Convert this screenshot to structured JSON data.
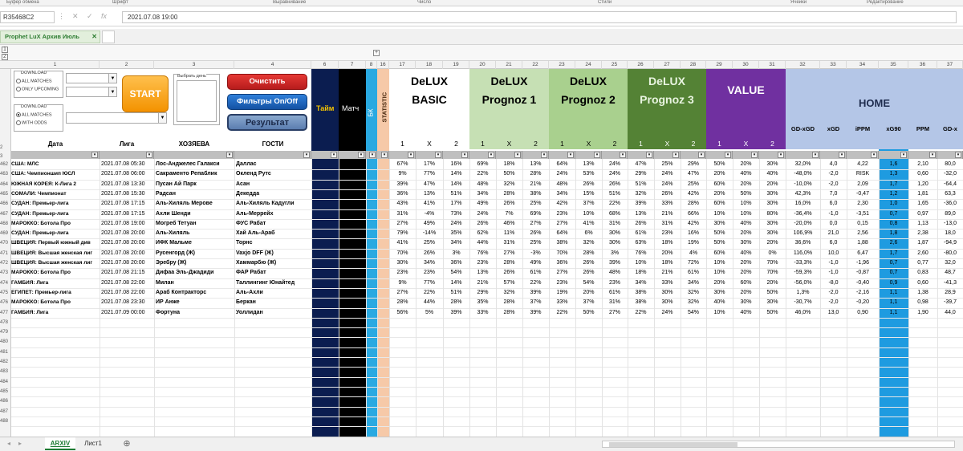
{
  "ribbon_groups": [
    "Буфер обмена",
    "Шрифт",
    "Выравнивание",
    "Число",
    "Стили",
    "Ячейки",
    "Редактирование"
  ],
  "namebox": "R35468C2",
  "formula_value": "2021.07.08 19:00",
  "workbook_tab": "Prophet LuX Архив Июль",
  "column_numbers": [
    "1",
    "2",
    "3",
    "4",
    "6",
    "7",
    "8",
    "16",
    "17",
    "18",
    "19",
    "20",
    "21",
    "22",
    "23",
    "24",
    "25",
    "26",
    "27",
    "28",
    "29",
    "30",
    "31",
    "32",
    "33",
    "34",
    "35",
    "36",
    "37"
  ],
  "row_header_top": "2",
  "row_header_filter": "3",
  "controls": {
    "download1_title": "DOWNLOAD",
    "download1_opt1": "ALL MATCHES",
    "download1_opt2": "ONLY UPCOMING",
    "download2_title": "DOWNLOAD",
    "download2_opt1": "ALL MATCHES",
    "download2_opt2": "WITH ODDS",
    "start": "START",
    "listbox_title": "Выбрать день",
    "btn_clear": "Очистить",
    "btn_filters": "Фильтры On/Off",
    "btn_result": "Результат"
  },
  "band_labels": {
    "taim": "Тайм",
    "match": "Матч",
    "bk": "БК",
    "statistic": "STATISTIC",
    "delux_basic_1": "DeLUX",
    "delux_basic_2": "BASIC",
    "p1_1": "DeLUX",
    "p1_2": "Prognoz 1",
    "p2_1": "DeLUX",
    "p2_2": "Prognoz 2",
    "p3_1": "DeLUX",
    "p3_2": "Prognoz 3",
    "value": "VALUE",
    "home": "HOME"
  },
  "home_cols": [
    "GD-xGD",
    "xGD",
    "iPPM",
    "xG90",
    "PPM",
    "GD-x"
  ],
  "col_headers": [
    "Дата",
    "Лига",
    "ХОЗЯЕВА",
    "ГОСТИ"
  ],
  "x12": [
    "1",
    "X",
    "2"
  ],
  "rows": [
    {
      "n": "462",
      "lg": "США: МЛС",
      "dt": "2021.07.08 05:30",
      "h": "Лос-Анджелес Галакси",
      "a": "Даллас",
      "v": [
        "67%",
        "17%",
        "16%",
        "69%",
        "18%",
        "13%",
        "64%",
        "13%",
        "24%",
        "47%",
        "25%",
        "29%",
        "50%",
        "20%",
        "30%",
        "32,0%",
        "4,0",
        "4,22",
        "1,6",
        "2,10",
        "80,0"
      ]
    },
    {
      "n": "463",
      "lg": "США: Чемпионшип ЮСЛ",
      "dt": "2021.07.08 06:00",
      "h": "Сакраменто Репаблик",
      "a": "Окленд Рутс",
      "v": [
        "9%",
        "77%",
        "14%",
        "22%",
        "50%",
        "28%",
        "24%",
        "53%",
        "24%",
        "29%",
        "24%",
        "47%",
        "20%",
        "40%",
        "40%",
        "-48,0%",
        "-2,0",
        "RISK",
        "1,3",
        "0,60",
        "-32,0"
      ]
    },
    {
      "n": "464",
      "lg": "ЮЖНАЯ КОРЕЯ: К-Лига 2",
      "dt": "2021.07.08 13:30",
      "h": "Пусан Ай Парк",
      "a": "Асан",
      "v": [
        "39%",
        "47%",
        "14%",
        "48%",
        "32%",
        "21%",
        "48%",
        "26%",
        "26%",
        "51%",
        "24%",
        "25%",
        "60%",
        "20%",
        "20%",
        "-10,0%",
        "-2,0",
        "2,09",
        "1,7",
        "1,20",
        "-64,4"
      ]
    },
    {
      "n": "465",
      "lg": "СОМАЛИ: Чемпионат",
      "dt": "2021.07.08 15:30",
      "h": "Радсан",
      "a": "Декедда",
      "v": [
        "36%",
        "13%",
        "51%",
        "34%",
        "28%",
        "38%",
        "34%",
        "15%",
        "51%",
        "32%",
        "26%",
        "42%",
        "20%",
        "50%",
        "30%",
        "42,3%",
        "7,0",
        "-0,47",
        "1,2",
        "1,81",
        "63,3"
      ]
    },
    {
      "n": "466",
      "lg": "СУДАН: Премьер-лига",
      "dt": "2021.07.08 17:15",
      "h": "Аль-Хиляль Мерове",
      "a": "Аль-Хиляль Кадугли",
      "v": [
        "43%",
        "41%",
        "17%",
        "49%",
        "26%",
        "25%",
        "42%",
        "37%",
        "22%",
        "39%",
        "33%",
        "28%",
        "60%",
        "10%",
        "30%",
        "16,0%",
        "6,0",
        "2,30",
        "1,0",
        "1,65",
        "-36,0"
      ]
    },
    {
      "n": "467",
      "lg": "СУДАН: Премьер-лига",
      "dt": "2021.07.08 17:15",
      "h": "Ахли Шенди",
      "a": "Аль-Меррейх",
      "v": [
        "31%",
        "-4%",
        "73%",
        "24%",
        "7%",
        "69%",
        "23%",
        "10%",
        "68%",
        "13%",
        "21%",
        "66%",
        "10%",
        "10%",
        "80%",
        "-36,4%",
        "-1,0",
        "-3,51",
        "0,7",
        "0,97",
        "89,0"
      ]
    },
    {
      "n": "468",
      "lg": "МАРОККО: Ботола Про",
      "dt": "2021.07.08 19:00",
      "h": "Могреб Тетуан",
      "a": "ФУС Рабат",
      "v": [
        "27%",
        "49%",
        "24%",
        "26%",
        "46%",
        "27%",
        "27%",
        "41%",
        "31%",
        "26%",
        "31%",
        "42%",
        "30%",
        "40%",
        "30%",
        "-20,0%",
        "0,0",
        "0,15",
        "0,8",
        "1,13",
        "-13,0"
      ]
    },
    {
      "n": "469",
      "lg": "СУДАН: Премьер-лига",
      "dt": "2021.07.08 20:00",
      "h": "Аль-Хиляль",
      "a": "Хай Аль-Араб",
      "v": [
        "79%",
        "-14%",
        "35%",
        "62%",
        "11%",
        "26%",
        "64%",
        "6%",
        "30%",
        "61%",
        "23%",
        "16%",
        "50%",
        "20%",
        "30%",
        "106,9%",
        "21,0",
        "2,56",
        "1,8",
        "2,38",
        "18,0"
      ]
    },
    {
      "n": "470",
      "lg": "ШВЕЦИЯ: Первый южный див",
      "dt": "2021.07.08 20:00",
      "h": "ИФК Мальме",
      "a": "Торнс",
      "v": [
        "41%",
        "25%",
        "34%",
        "44%",
        "31%",
        "25%",
        "38%",
        "32%",
        "30%",
        "63%",
        "18%",
        "19%",
        "50%",
        "30%",
        "20%",
        "36,6%",
        "6,0",
        "1,88",
        "2,6",
        "1,87",
        "-94,9"
      ]
    },
    {
      "n": "471",
      "lg": "ШВЕЦИЯ: Высшая женская лиг",
      "dt": "2021.07.08 20:00",
      "h": "Русенгорд (Ж)",
      "a": "Vaxjo DFF (Ж)",
      "v": [
        "70%",
        "26%",
        "3%",
        "76%",
        "27%",
        "-3%",
        "70%",
        "28%",
        "3%",
        "76%",
        "20%",
        "4%",
        "60%",
        "40%",
        "0%",
        "116,0%",
        "10,0",
        "6,47",
        "1,7",
        "2,60",
        "-80,0"
      ]
    },
    {
      "n": "472",
      "lg": "ШВЕЦИЯ: Высшая женская лиг",
      "dt": "2021.07.08 20:00",
      "h": "Эребру (Ж)",
      "a": "Хаммарбю (Ж)",
      "v": [
        "30%",
        "34%",
        "36%",
        "23%",
        "28%",
        "49%",
        "36%",
        "26%",
        "39%",
        "10%",
        "18%",
        "72%",
        "10%",
        "20%",
        "70%",
        "-33,3%",
        "-1,0",
        "-1,96",
        "0,7",
        "0,77",
        "32,0"
      ]
    },
    {
      "n": "473",
      "lg": "МАРОККО: Ботола Про",
      "dt": "2021.07.08 21:15",
      "h": "Дифаа Эль-Джадиди",
      "a": "ФАР Рабат",
      "v": [
        "23%",
        "23%",
        "54%",
        "13%",
        "26%",
        "61%",
        "27%",
        "26%",
        "48%",
        "18%",
        "21%",
        "61%",
        "10%",
        "20%",
        "70%",
        "-59,3%",
        "-1,0",
        "-0,87",
        "0,7",
        "0,83",
        "48,7"
      ]
    },
    {
      "n": "474",
      "lg": "ГАМБИЯ: Лига",
      "dt": "2021.07.08 22:00",
      "h": "Милан",
      "a": "Таллингинг Юнайтед",
      "v": [
        "9%",
        "77%",
        "14%",
        "21%",
        "57%",
        "22%",
        "23%",
        "54%",
        "23%",
        "34%",
        "33%",
        "34%",
        "20%",
        "60%",
        "20%",
        "-56,0%",
        "-8,0",
        "-0,40",
        "0,9",
        "0,60",
        "-41,3"
      ]
    },
    {
      "n": "475",
      "lg": "ЕГИПЕТ: Премьер-лига",
      "dt": "2021.07.08 22:00",
      "h": "Араб Контракторс",
      "a": "Аль-Ахли",
      "v": [
        "27%",
        "22%",
        "51%",
        "29%",
        "32%",
        "39%",
        "19%",
        "20%",
        "61%",
        "38%",
        "30%",
        "32%",
        "30%",
        "20%",
        "50%",
        "1,3%",
        "-2,0",
        "-2,16",
        "1,1",
        "1,38",
        "28,9"
      ]
    },
    {
      "n": "476",
      "lg": "МАРОККО: Ботола Про",
      "dt": "2021.07.08 23:30",
      "h": "ИР Анже",
      "a": "Беркан",
      "v": [
        "28%",
        "44%",
        "28%",
        "35%",
        "28%",
        "37%",
        "33%",
        "37%",
        "31%",
        "38%",
        "30%",
        "32%",
        "40%",
        "30%",
        "30%",
        "-30,7%",
        "-2,0",
        "-0,20",
        "1,1",
        "0,98",
        "-39,7"
      ]
    },
    {
      "n": "477",
      "lg": "ГАМБИЯ: Лига",
      "dt": "2021.07.09 00:00",
      "h": "Фортуна",
      "a": "Уоллидан",
      "v": [
        "56%",
        "5%",
        "39%",
        "33%",
        "28%",
        "39%",
        "22%",
        "50%",
        "27%",
        "22%",
        "24%",
        "54%",
        "10%",
        "40%",
        "50%",
        "46,0%",
        "13,0",
        "0,90",
        "1,1",
        "1,90",
        "44,0"
      ]
    }
  ],
  "empty_rows": [
    "478",
    "479",
    "480",
    "481",
    "482",
    "483",
    "484",
    "485",
    "486",
    "487",
    "488"
  ],
  "sheet_tabs": [
    "ARXIV",
    "Лист1"
  ]
}
